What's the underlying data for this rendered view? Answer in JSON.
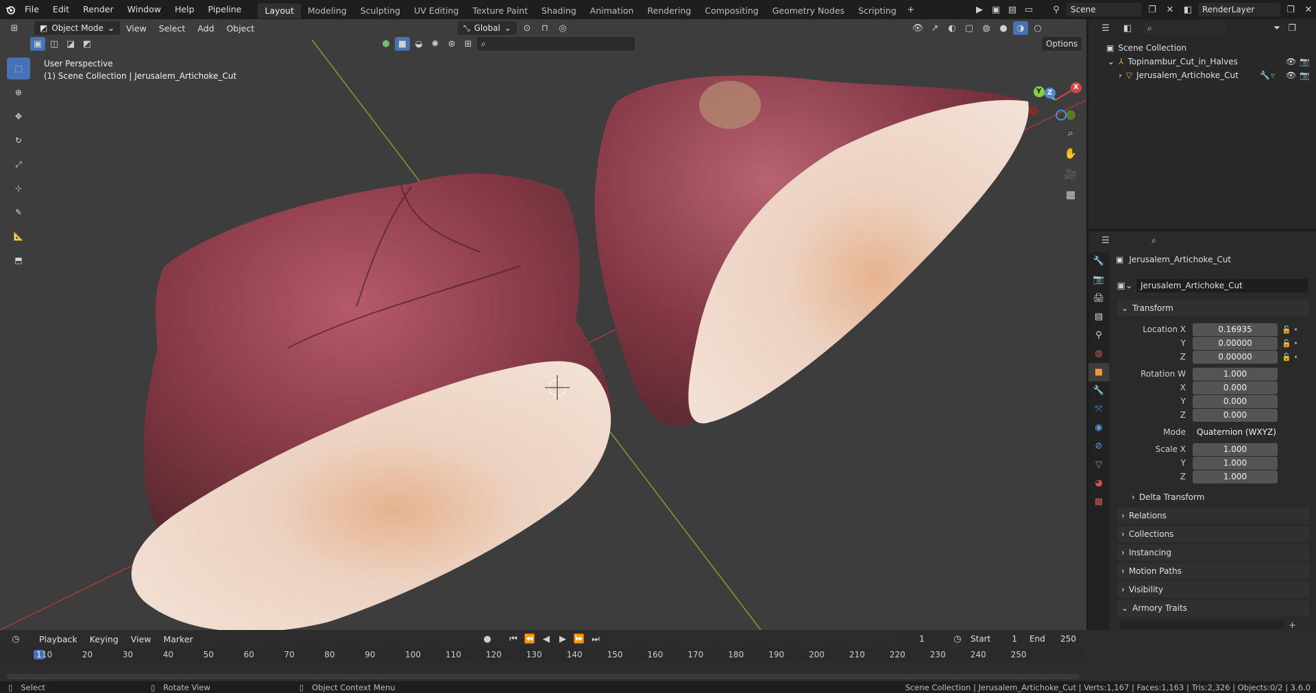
{
  "topbar": {
    "menus": [
      "File",
      "Edit",
      "Render",
      "Window",
      "Help",
      "Pipeline"
    ],
    "workspaces": [
      "Layout",
      "Modeling",
      "Sculpting",
      "UV Editing",
      "Texture Paint",
      "Shading",
      "Animation",
      "Rendering",
      "Compositing",
      "Geometry Nodes",
      "Scripting"
    ],
    "active_workspace": "Layout",
    "scene_name": "Scene",
    "view_layer": "RenderLayer"
  },
  "viewport": {
    "mode": "Object Mode",
    "menus": [
      "View",
      "Select",
      "Add",
      "Object"
    ],
    "orientation": "Global",
    "options": "Options",
    "perspective_label": "User Perspective",
    "context_label": "(1) Scene Collection | Jerusalem_Artichoke_Cut",
    "gizmo_axes": {
      "x": "X",
      "y": "Y",
      "z": "Z"
    }
  },
  "outliner": {
    "root": "Scene Collection",
    "items": [
      {
        "name": "Topinambur_Cut_in_Halves"
      },
      {
        "name": "Jerusalem_Artichoke_Cut"
      }
    ]
  },
  "properties": {
    "object_name": "Jerusalem_Artichoke_Cut",
    "object_field": "Jerusalem_Artichoke_Cut",
    "transform": {
      "header": "Transform",
      "location_label": "Location X",
      "location": [
        "0.16935",
        "0.00000",
        "0.00000"
      ],
      "rotation_label": "Rotation W",
      "rotation": [
        "1.000",
        "0.000",
        "0.000",
        "0.000"
      ],
      "mode_label": "Mode",
      "mode_value": "Quaternion (WXYZ)",
      "scale_label": "Scale X",
      "scale": [
        "1.000",
        "1.000",
        "1.000"
      ],
      "axis_y": "Y",
      "axis_z": "Z",
      "axis_x": "X"
    },
    "panels": [
      "Delta Transform",
      "Relations",
      "Collections",
      "Instancing",
      "Motion Paths",
      "Visibility",
      "Armory Traits"
    ]
  },
  "timeline": {
    "menus": [
      "Playback",
      "Keying",
      "View",
      "Marker"
    ],
    "current_frame": "1",
    "start_label": "Start",
    "start": "1",
    "end_label": "End",
    "end": "250",
    "ticks": [
      "1",
      "10",
      "20",
      "30",
      "40",
      "50",
      "60",
      "70",
      "80",
      "90",
      "100",
      "110",
      "120",
      "130",
      "140",
      "150",
      "160",
      "170",
      "180",
      "190",
      "200",
      "210",
      "220",
      "230",
      "240",
      "250"
    ]
  },
  "statusbar": {
    "select": "Select",
    "rotate": "Rotate View",
    "context_menu": "Object Context Menu",
    "stats": "Scene Collection | Jerusalem_Artichoke_Cut | Verts:1,167 | Faces:1,163 | Tris:2,326 | Objects:0/2 | 3.6.0"
  },
  "colors": {
    "accent": "#4772b3",
    "skin": "#8a3b48",
    "flesh": "#ead3c2",
    "grid_green": "#7fa02a",
    "grid_red": "#a33a3a"
  }
}
